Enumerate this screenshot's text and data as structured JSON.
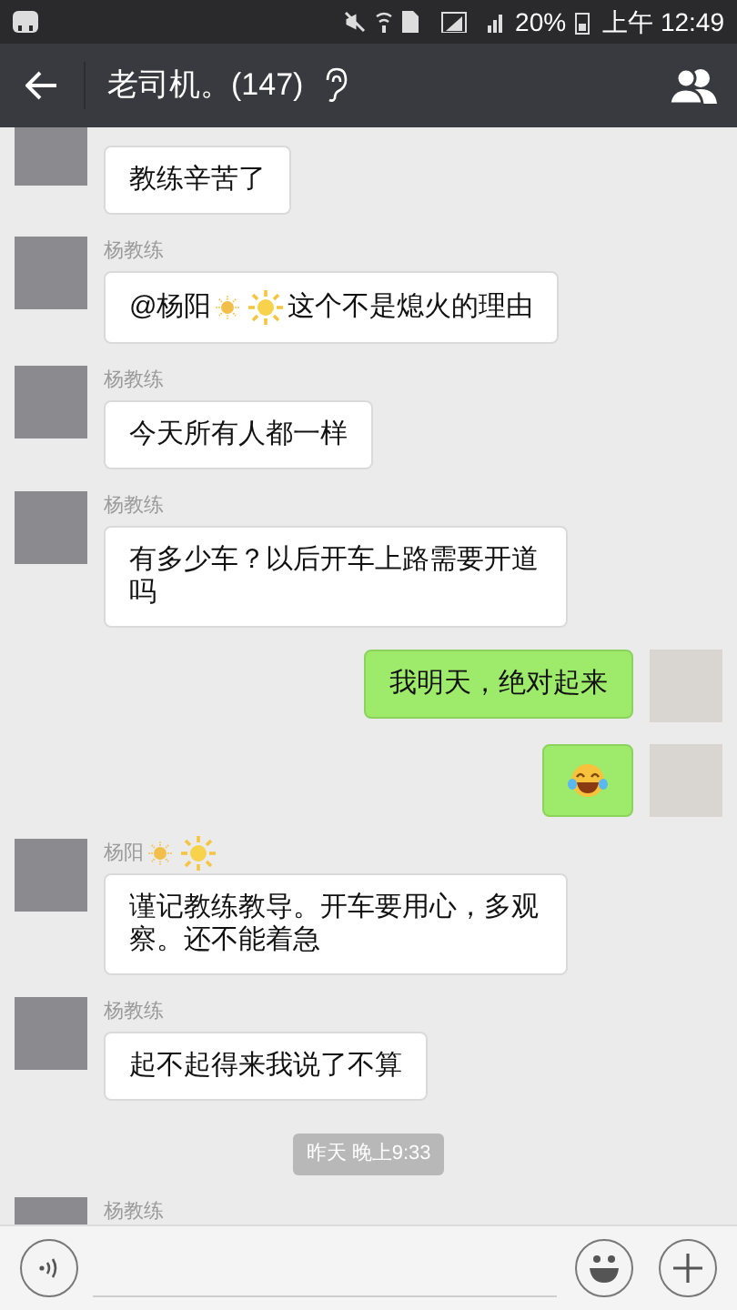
{
  "status_bar": {
    "battery_text": "20%",
    "time": "上午 12:49"
  },
  "header": {
    "title": "老司机。(147)"
  },
  "messages": [
    {
      "kind": "message",
      "outgoing": false,
      "parts": [
        {
          "kind": "text",
          "text": "教练辛苦了"
        }
      ]
    },
    {
      "kind": "message",
      "outgoing": false,
      "sender": [
        {
          "kind": "text",
          "text": "杨教练"
        }
      ],
      "parts": [
        {
          "kind": "text",
          "text": "@杨阳"
        },
        {
          "kind": "sun_small"
        },
        {
          "kind": "sun"
        },
        {
          "kind": "text",
          "text": "这个不是熄火的理由"
        }
      ]
    },
    {
      "kind": "message",
      "outgoing": false,
      "sender": [
        {
          "kind": "text",
          "text": "杨教练"
        }
      ],
      "parts": [
        {
          "kind": "text",
          "text": "今天所有人都一样"
        }
      ]
    },
    {
      "kind": "message",
      "outgoing": false,
      "sender": [
        {
          "kind": "text",
          "text": "杨教练"
        }
      ],
      "parts": [
        {
          "kind": "text",
          "text": "有多少车？以后开车上路需要开道吗"
        }
      ]
    },
    {
      "kind": "message",
      "outgoing": true,
      "parts": [
        {
          "kind": "text",
          "text": "我明天，绝对起来"
        }
      ]
    },
    {
      "kind": "message",
      "outgoing": true,
      "parts": [
        {
          "kind": "laugh"
        }
      ]
    },
    {
      "kind": "message",
      "outgoing": false,
      "sender": [
        {
          "kind": "text",
          "text": "杨阳"
        },
        {
          "kind": "sun_small"
        },
        {
          "kind": "sun"
        }
      ],
      "parts": [
        {
          "kind": "text",
          "text": "谨记教练教导。开车要用心，多观察。还不能着急"
        }
      ]
    },
    {
      "kind": "message",
      "outgoing": false,
      "sender": [
        {
          "kind": "text",
          "text": "杨教练"
        }
      ],
      "parts": [
        {
          "kind": "text",
          "text": "起不起得来我说了不算"
        }
      ]
    },
    {
      "kind": "time",
      "text": "昨天 晚上9:33"
    },
    {
      "kind": "message",
      "outgoing": false,
      "sender": [
        {
          "kind": "text",
          "text": "杨教练"
        }
      ]
    }
  ]
}
